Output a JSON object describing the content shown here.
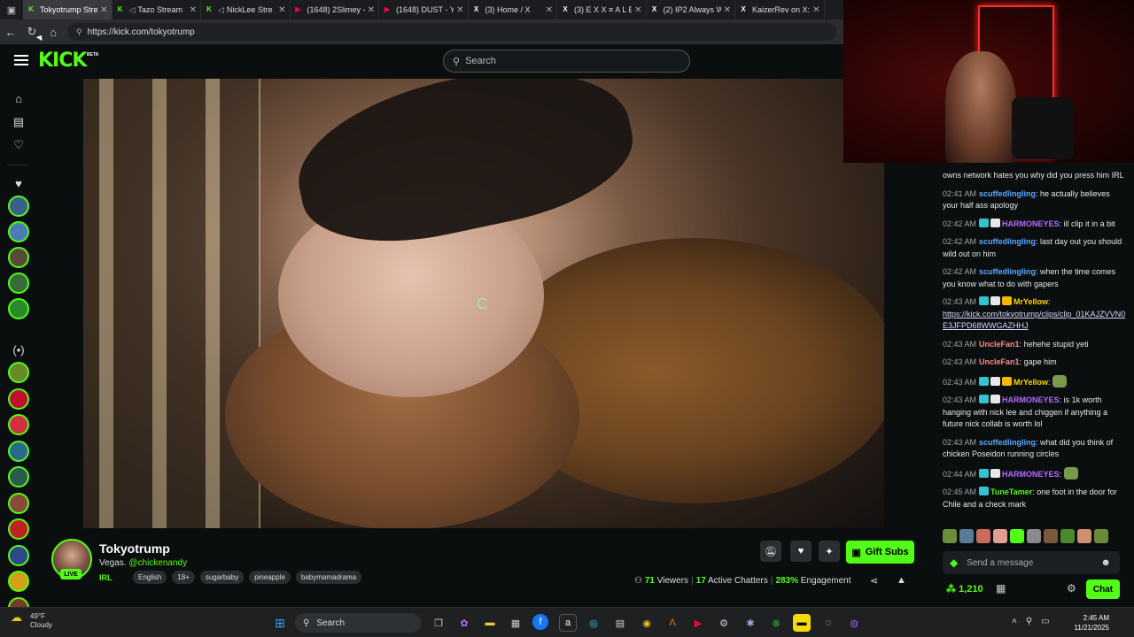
{
  "browser": {
    "tabs": [
      {
        "title": "Tokyotrump Stre",
        "favicon": "kick-icon",
        "favicon_color": "#53fc18",
        "active": true
      },
      {
        "title": "Tazo Stream",
        "favicon": "kick-icon",
        "favicon_color": "#53fc18",
        "muted": true
      },
      {
        "title": "NickLee Stre",
        "favicon": "kick-icon",
        "favicon_color": "#53fc18",
        "muted": true
      },
      {
        "title": "(1648) 2Slimey - V",
        "favicon": "youtube-icon",
        "favicon_color": "#ff0033"
      },
      {
        "title": "(1648) DUST - Yo",
        "favicon": "youtube-icon",
        "favicon_color": "#ff0033"
      },
      {
        "title": "(3) Home / X",
        "favicon": "x-icon",
        "favicon_color": "#ffffff"
      },
      {
        "title": "(3) E X X ≡ A L E",
        "favicon": "x-icon",
        "favicon_color": "#ffffff"
      },
      {
        "title": "(2) IP2 Always W",
        "favicon": "x-icon",
        "favicon_color": "#ffffff"
      },
      {
        "title": "KaizerRev on X: \"",
        "favicon": "x-icon",
        "favicon_color": "#ffffff"
      }
    ],
    "url": "https://kick.com/tokyotrump"
  },
  "header": {
    "logo": "KICK",
    "logo_badge": "BETA",
    "search_placeholder": "Search"
  },
  "sidebar": {
    "avatar_colors": [
      "#3b5f8a",
      "#4a7bb5",
      "#5a4a3a",
      "#3a6a3a",
      "#2a8a2a",
      "#6a8a2a",
      "#c0102a",
      "#d03040",
      "#2a6a8a",
      "#2a5a4a",
      "#8a4a3a",
      "#c02020",
      "#2a4a8a",
      "#d4a017",
      "#7a3a2a"
    ]
  },
  "channel": {
    "name": "Tokyotrump",
    "live_label": "LIVE",
    "title_text": "Vegas. ",
    "title_mention": "@chickenandy",
    "category": "IRL",
    "tags": [
      "English",
      "18+",
      "sugarbaby",
      "pineapple",
      "babymamadrama"
    ],
    "gift_label": "Gift Subs",
    "viewers": "71",
    "viewers_label": "Viewers",
    "chatters": "17",
    "chatters_label": "Active Chatters",
    "engagement": "283%",
    "engagement_label": "Engagement"
  },
  "chat": {
    "messages": [
      {
        "time": "",
        "user": "",
        "color": "#ffffff",
        "text": "owns network hates you why did you press him IRL"
      },
      {
        "time": "02:41 AM",
        "user": "scuffedlingling",
        "color": "#5aa8ff",
        "text": "he actually believes your half ass apology"
      },
      {
        "time": "02:42 AM",
        "user": "HARMONEYES",
        "color": "#b66bff",
        "badges": 2,
        "text": "ill clip it in a bit"
      },
      {
        "time": "02:42 AM",
        "user": "scuffedlingling",
        "color": "#5aa8ff",
        "text": "last day out you should wild out on him"
      },
      {
        "time": "02:42 AM",
        "user": "scuffedlingling",
        "color": "#5aa8ff",
        "text": "when the time comes you know what to do with gapers"
      },
      {
        "time": "02:43 AM",
        "user": "MrYellow",
        "color": "#ffd400",
        "badges": 3,
        "text": "",
        "link": "https://kick.com/tokyotrump/clips/clip_01KAJZVVN0E3JFPD68WWGAZHHJ"
      },
      {
        "time": "02:43 AM",
        "user": "UncleFan1",
        "color": "#ff8a8a",
        "text": "hehehe stupid yeti"
      },
      {
        "time": "02:43 AM",
        "user": "UncleFan1",
        "color": "#ff8a8a",
        "text": "gape him"
      },
      {
        "time": "02:43 AM",
        "user": "MrYellow",
        "color": "#ffd400",
        "badges": 3,
        "text": ""
      },
      {
        "time": "02:43 AM",
        "user": "HARMONEYES",
        "color": "#b66bff",
        "badges": 2,
        "text": "is 1k worth hanging with nick lee and chiggen if anything a future nick collab is worth lol"
      },
      {
        "time": "02:43 AM",
        "user": "scuffedlingling",
        "color": "#5aa8ff",
        "text": "what did you think of chicken Poseidon running circles"
      },
      {
        "time": "02:44 AM",
        "user": "HARMONEYES",
        "color": "#b66bff",
        "badges": 2,
        "text": ""
      },
      {
        "time": "02:45 AM",
        "user": "TuneTamer",
        "color": "#53fc18",
        "badges": 1,
        "text": "one foot in the door for Chile and a check mark"
      }
    ],
    "input_placeholder": "Send a message",
    "points": "1,210",
    "chat_button": "Chat"
  },
  "taskbar": {
    "temp": "49°F",
    "condition": "Cloudy",
    "search_label": "Search",
    "time": "2:45 AM",
    "date": "11/21/2025"
  }
}
